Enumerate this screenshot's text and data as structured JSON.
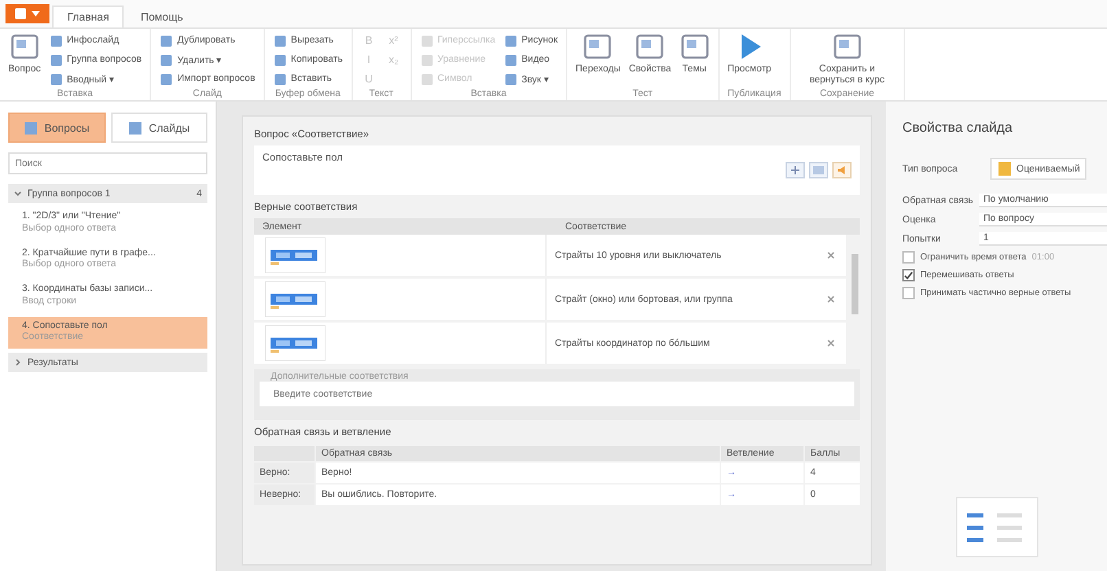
{
  "ribbon_tabs": [
    {
      "label": "Главная",
      "selected": true
    },
    {
      "label": "Помощь",
      "selected": false
    }
  ],
  "ribbon_groups": [
    {
      "label": "Вставка",
      "buttons": [
        {
          "label": "Вопрос",
          "kind": "large",
          "disabled": false
        },
        {
          "label": "Инфослайд",
          "kind": "small",
          "disabled": false
        },
        {
          "label": "Группа вопросов",
          "kind": "small",
          "disabled": false
        },
        {
          "label": "Вводный ▾",
          "kind": "small",
          "disabled": false
        }
      ]
    },
    {
      "label": "Слайд",
      "buttons": [
        {
          "label": "Дублировать",
          "kind": "small",
          "disabled": false
        },
        {
          "label": "Удалить ▾",
          "kind": "small",
          "disabled": false
        },
        {
          "label": "Импорт вопросов",
          "kind": "small",
          "disabled": false
        }
      ]
    },
    {
      "label": "Буфер обмена",
      "buttons": [
        {
          "label": "Вырезать",
          "kind": "small",
          "disabled": false
        },
        {
          "label": "Копировать",
          "kind": "small",
          "disabled": false
        },
        {
          "label": "Вставить",
          "kind": "small",
          "disabled": false
        }
      ]
    },
    {
      "label": "Текст",
      "buttons": [
        {
          "label": "B",
          "kind": "glyph",
          "disabled": true
        },
        {
          "label": "I",
          "kind": "glyph",
          "disabled": true
        },
        {
          "label": "U",
          "kind": "glyph",
          "disabled": true
        },
        {
          "label": "x²",
          "kind": "glyph",
          "disabled": true
        },
        {
          "label": "x₂",
          "kind": "glyph",
          "disabled": true
        }
      ]
    },
    {
      "label": "Вставка",
      "buttons": [
        {
          "label": "Гиперссылка",
          "kind": "small",
          "disabled": true
        },
        {
          "label": "Уравнение",
          "kind": "small",
          "disabled": true
        },
        {
          "label": "Символ",
          "kind": "small",
          "disabled": true
        },
        {
          "label": "Рисунок",
          "kind": "small",
          "disabled": false
        },
        {
          "label": "Видео",
          "kind": "small",
          "disabled": false
        },
        {
          "label": "Звук ▾",
          "kind": "small",
          "disabled": false
        }
      ]
    },
    {
      "label": "Тест",
      "buttons": [
        {
          "label": "Переходы",
          "kind": "large",
          "disabled": false
        },
        {
          "label": "Свойства",
          "kind": "large",
          "disabled": false
        },
        {
          "label": "Темы",
          "kind": "large",
          "disabled": false
        }
      ]
    },
    {
      "label": "Публикация",
      "buttons": [
        {
          "label": "Просмотр",
          "kind": "large",
          "disabled": false
        }
      ]
    },
    {
      "label": "Сохранение",
      "buttons": [
        {
          "label": "Сохранить и вернуться в курс",
          "kind": "large",
          "disabled": false
        }
      ]
    }
  ],
  "left_tabs": [
    {
      "label": "Вопросы",
      "selected": true
    },
    {
      "label": "Слайды",
      "selected": false
    }
  ],
  "search": {
    "placeholder": "Поиск"
  },
  "tree": [
    {
      "label": "Группа вопросов 1",
      "expanded": true,
      "badge": "4",
      "children": [
        {
          "number": "1.",
          "title": "\"2D/3\" или \"Чтение\"",
          "type": "Выбор одного ответа",
          "selected": false
        },
        {
          "number": "2.",
          "title": "Кратчайшие пути в графе...",
          "type": "Выбор одного ответа",
          "selected": false
        },
        {
          "number": "3.",
          "title": "Координаты базы записи...",
          "type": "Ввод строки",
          "selected": false
        },
        {
          "number": "4.",
          "title": "Сопоставьте пол",
          "type": "Соответствие",
          "selected": true
        }
      ]
    },
    {
      "label": "Результаты",
      "expanded": false
    }
  ],
  "question": {
    "heading": "Вопрос «Соответствие»",
    "text": "Сопоставьте пол"
  },
  "matches": {
    "heading": "Верные соответствия",
    "columns": [
      "Элемент",
      "Соответствие"
    ],
    "rows": [
      {
        "match": "Страйты 10 уровня или выключатель"
      },
      {
        "match": "Страйт (окно) или бортовая, или группа"
      },
      {
        "match": "Страйты координатор по бóльшим"
      }
    ]
  },
  "extra": {
    "heading": "Дополнительные соответствия",
    "placeholder": "Введите соответствие"
  },
  "feedback": {
    "heading": "Обратная связь и ветвление",
    "columns": [
      "Обратная связь",
      "Ветвление",
      "Баллы"
    ],
    "rows": [
      {
        "label": "Верно:",
        "text": "Верно!",
        "branch": "→",
        "score": "4"
      },
      {
        "label": "Неверно:",
        "text": "Вы ошиблись. Повторите.",
        "branch": "→",
        "score": "0"
      }
    ]
  },
  "properties": {
    "title": "Свойства слайда",
    "type_label": "Тип вопроса",
    "type_value": "Оцениваемый",
    "fields": [
      {
        "label": "Обратная связь",
        "value": "По умолчанию"
      },
      {
        "label": "Оценка",
        "value": "По вопросу"
      },
      {
        "label": "Попытки",
        "value": "1"
      }
    ],
    "options": [
      {
        "label": "Ограничить время ответа",
        "checked": false,
        "extra": "01:00"
      },
      {
        "label": "Перемешивать ответы",
        "checked": true
      },
      {
        "label": "Принимать частично верные ответы",
        "checked": false
      }
    ]
  }
}
